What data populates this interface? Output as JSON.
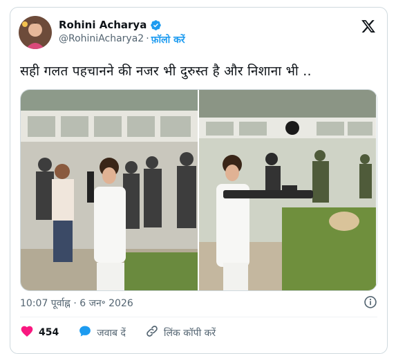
{
  "tweet": {
    "author_name": "Rohini Acharya",
    "author_handle": "@RohiniAcharya2",
    "separator": "·",
    "follow_label": "फ़ॉलो करें",
    "text": "सही गलत पहचानने की नजर भी दुरुस्त है और निशाना भी ..",
    "timestamp": "10:07 पूर्वाह्न · 6 जन॰ 2026",
    "likes": "454",
    "reply_label": "जवाब दें",
    "copy_link_label": "लिंक कॉपी करें"
  },
  "icons": {
    "verified": "verified-badge-icon",
    "x_logo": "x-logo-icon",
    "info": "info-icon",
    "heart": "heart-icon",
    "reply": "reply-bubble-icon",
    "link": "link-icon"
  },
  "colors": {
    "accent": "#1d9bf0",
    "like": "#f91880",
    "muted": "#536471"
  }
}
